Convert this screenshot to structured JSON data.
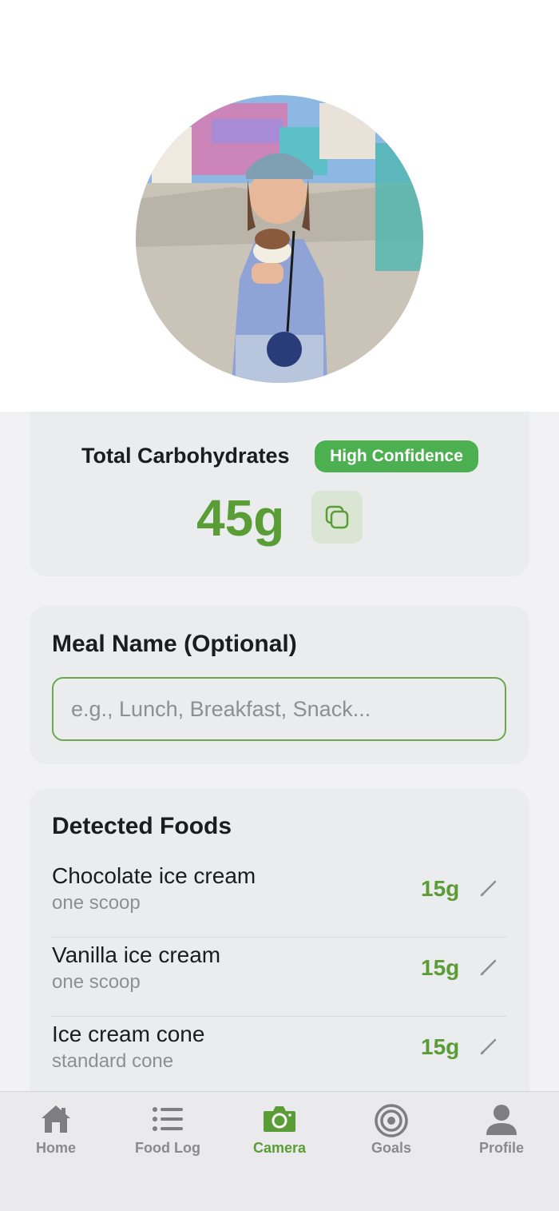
{
  "summary": {
    "title": "Total Carbohydrates",
    "confidence_badge": "High Confidence",
    "total_value": "45g",
    "copy_icon": "copy-icon"
  },
  "meal": {
    "section_title": "Meal Name (Optional)",
    "placeholder": "e.g., Lunch, Breakfast, Snack...",
    "value": ""
  },
  "foods": {
    "section_title": "Detected Foods",
    "items": [
      {
        "name": "Chocolate ice cream",
        "portion": "one scoop",
        "carbs": "15g"
      },
      {
        "name": "Vanilla ice cream",
        "portion": "one scoop",
        "carbs": "15g"
      },
      {
        "name": "Ice cream cone",
        "portion": "standard cone",
        "carbs": "15g"
      }
    ]
  },
  "tabbar": {
    "items": [
      {
        "label": "Home",
        "icon": "house-icon"
      },
      {
        "label": "Food Log",
        "icon": "list-icon"
      },
      {
        "label": "Camera",
        "icon": "camera-icon"
      },
      {
        "label": "Goals",
        "icon": "target-icon"
      },
      {
        "label": "Profile",
        "icon": "person-icon"
      }
    ],
    "active": "Camera"
  },
  "colors": {
    "accent_green": "#5a9d36",
    "badge_green": "#4caf50",
    "card_bg": "#ebecee",
    "page_bg": "#f2f2f4"
  }
}
